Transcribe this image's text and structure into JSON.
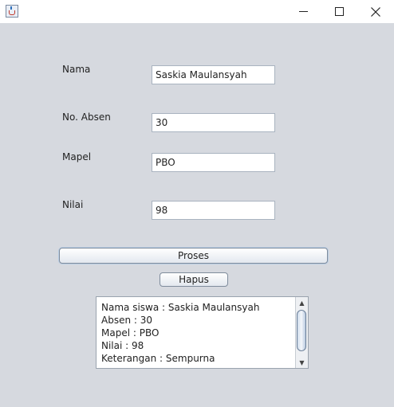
{
  "window": {
    "icons": {
      "app": "java-cup-icon",
      "minimize": "minimize-icon",
      "maximize": "maximize-icon",
      "close": "close-icon"
    }
  },
  "form": {
    "nama": {
      "label": "Nama",
      "value": "Saskia Maulansyah"
    },
    "absen": {
      "label": "No. Absen",
      "value": "30"
    },
    "mapel": {
      "label": "Mapel",
      "value": "PBO"
    },
    "nilai": {
      "label": "Nilai",
      "value": "98"
    }
  },
  "buttons": {
    "proses": "Proses",
    "hapus": "Hapus"
  },
  "output": {
    "lines": [
      "Nama siswa : Saskia Maulansyah",
      "Absen : 30",
      "Mapel : PBO",
      "Nilai : 98",
      "Keterangan : Sempurna"
    ]
  }
}
